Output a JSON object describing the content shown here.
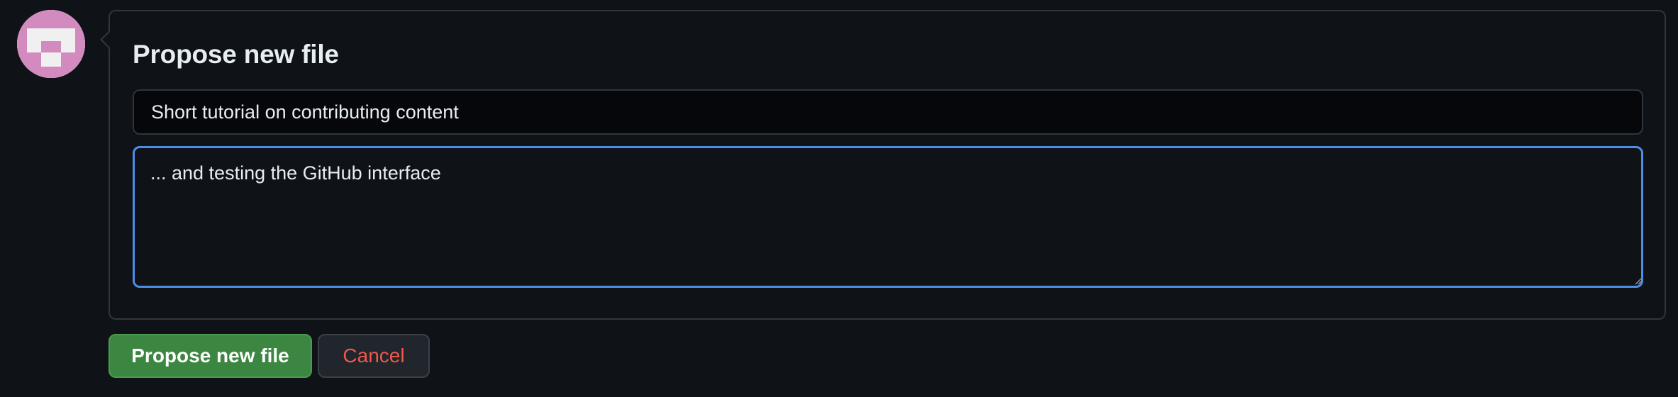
{
  "form": {
    "heading": "Propose new file",
    "title_value": "Short tutorial on contributing content",
    "description_value": "... and testing the GitHub interface"
  },
  "actions": {
    "submit_label": "Propose new file",
    "cancel_label": "Cancel"
  },
  "avatar": {
    "icon": "identicon-avatar"
  },
  "colors": {
    "background": "#0f1217",
    "primary_button": "#3b8640",
    "cancel_text": "#f0584c",
    "focus_border": "#4c8ee6",
    "avatar_pink": "#d38bbf"
  }
}
